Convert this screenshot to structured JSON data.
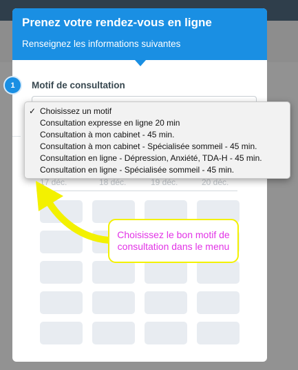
{
  "booking": {
    "title": "Prenez votre rendez-vous en ligne",
    "subtitle": "Renseignez les informations suivantes"
  },
  "step": {
    "number": "1",
    "label": "Motif de consultation"
  },
  "dropdown": {
    "selected_index": 0,
    "options": [
      "Choisissez un motif",
      "Consultation expresse en ligne 20 min",
      "Consultation à mon cabinet - 45 min.",
      "Consultation à mon cabinet - Spécialisée sommeil - 45 min.",
      "Consultation en ligne - Dépression, Anxiété, TDA-H - 45 min.",
      "Consultation en ligne - Spécialisée sommeil - 45 min."
    ]
  },
  "calendar": {
    "days": [
      "17 déc.",
      "18 déc.",
      "19 déc.",
      "20 déc."
    ]
  },
  "annotation": {
    "text": "Choisissez le bon motif de consultation dans le menu",
    "text_color": "#e233e6",
    "arrow_color": "#f3f100"
  },
  "colors": {
    "accent": "#1a8fe3",
    "overlay": "#929292"
  }
}
